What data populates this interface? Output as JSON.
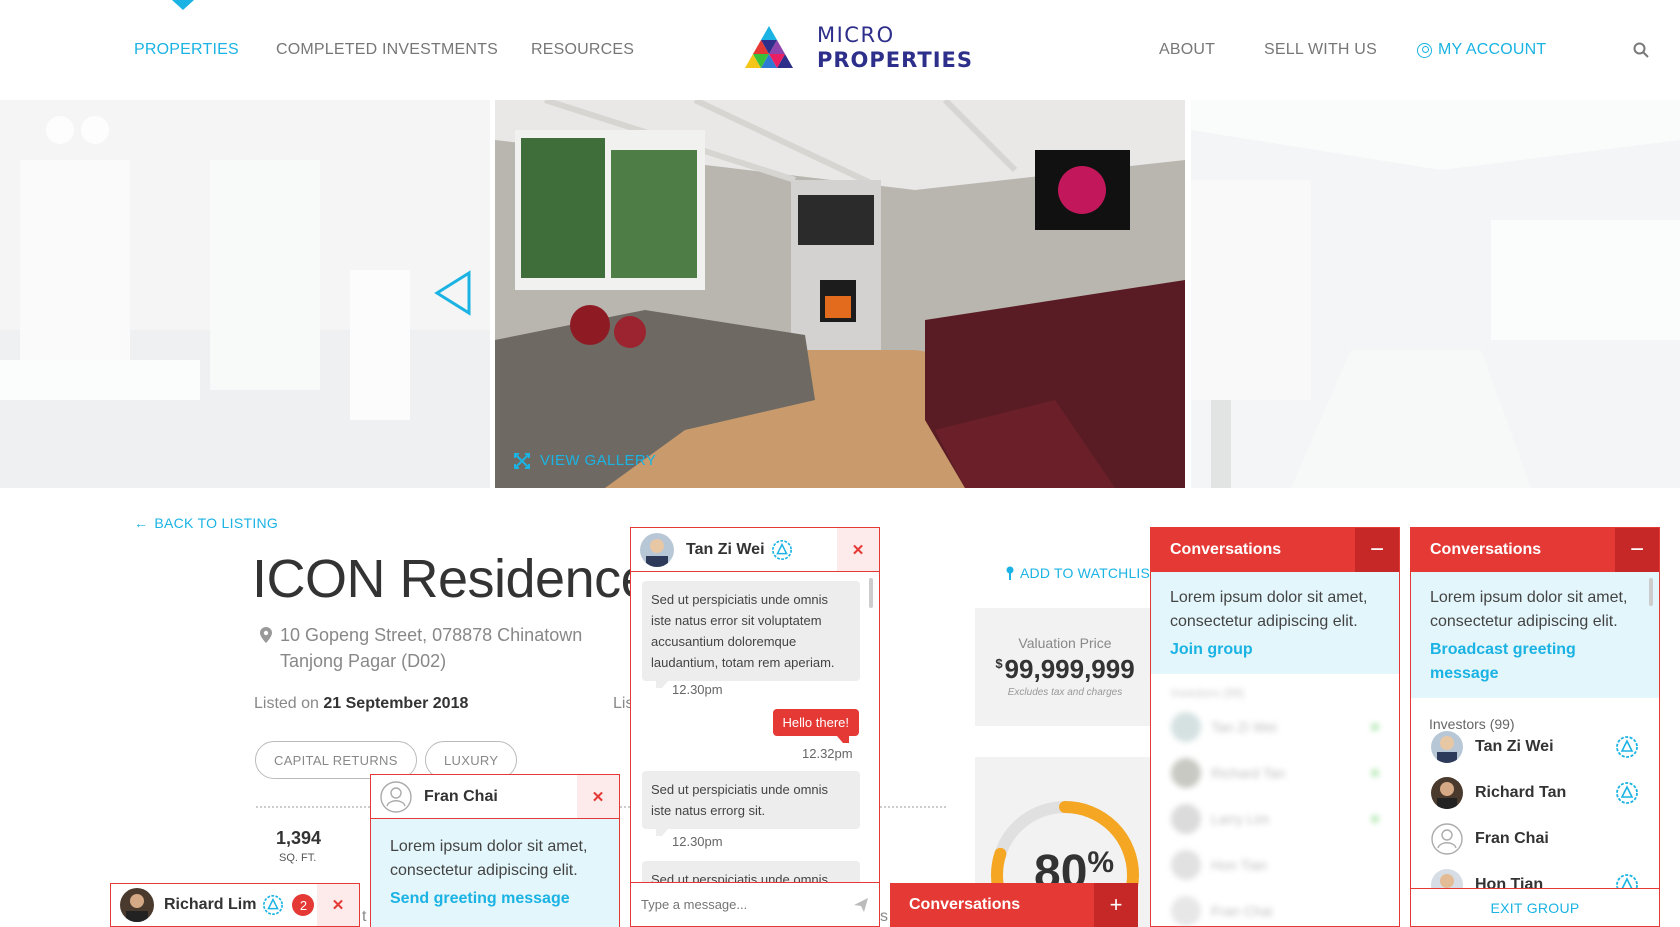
{
  "nav": {
    "left": [
      "PROPERTIES",
      "COMPLETED INVESTMENTS",
      "RESOURCES"
    ],
    "right": [
      "ABOUT",
      "SELL WITH US"
    ],
    "account": "MY ACCOUNT"
  },
  "logo": {
    "line1": "MICRO",
    "line2": "PROPERTIES"
  },
  "gallery": {
    "view_label": "VIEW GALLERY"
  },
  "property": {
    "back_label": "BACK TO LISTING",
    "title": "ICON Residences",
    "address_line1": "10 Gopeng Street, 078878 Chinatown",
    "address_line2": "Tanjong Pagar (D02)",
    "listed_prefix": "Listed on",
    "listed_date": "21 September 2018",
    "listed_clip": "Lis",
    "tags": [
      "CAPITAL RETURNS",
      "LUXURY"
    ],
    "area_value": "1,394",
    "area_unit": "SQ. FT.",
    "watchlist_label": "ADD TO WATCHLIST",
    "valuation_label": "Valuation Price",
    "valuation_currency": "$",
    "valuation_value": "99,999,999",
    "valuation_note": "Excludes tax and charges",
    "gauge_value": 80,
    "gauge_number": "80",
    "gauge_unit": "%",
    "clip_s": "s",
    "clip_t": "t"
  },
  "tan_chat": {
    "name": "Tan Zi Wei",
    "messages": [
      {
        "text": "Sed ut perspiciatis unde omnis iste natus error sit voluptatem accusantium doloremque laudantium, totam rem aperiam.",
        "time": "12.30pm"
      },
      {
        "text": "Hello there!",
        "time": "12.32pm"
      },
      {
        "text": "Sed ut perspiciatis unde omnis iste natus errorg sit.",
        "time": "12.30pm"
      },
      {
        "text": "Sed ut perspiciatis unde omnis"
      }
    ],
    "input_placeholder": "Type a message..."
  },
  "fran_chat": {
    "name": "Fran Chai",
    "body": "Lorem ipsum dolor sit amet, consectetur adipiscing elit.",
    "action": "Send greeting message"
  },
  "richard_chat": {
    "name": "Richard Lim",
    "unread": "2"
  },
  "conv_bar": {
    "title": "Conversations",
    "action_symbol": "+"
  },
  "conv_panel_1": {
    "title": "Conversations",
    "body": "Lorem ipsum dolor sit amet, consectetur adipiscing elit.",
    "action": "Join group",
    "blurred_label": "Investors (99)",
    "blurred_names": [
      "Tan Zi Wei",
      "Richard Tan",
      "Larry Lim",
      "Hon Tian",
      "Fran Chai"
    ]
  },
  "conv_panel_2": {
    "title": "Conversations",
    "body": "Lorem ipsum dolor sit amet, consectetur adipiscing elit.",
    "action": "Broadcast greeting message",
    "investors_label": "Investors (99)",
    "investors": [
      "Tan Zi Wei",
      "Richard Tan",
      "Fran Chai",
      "Hon Tian"
    ],
    "exit_label": "EXIT GROUP"
  },
  "colors": {
    "accent": "#1ab3e3",
    "alert": "#e53935",
    "brand": "#2e2f8a"
  }
}
